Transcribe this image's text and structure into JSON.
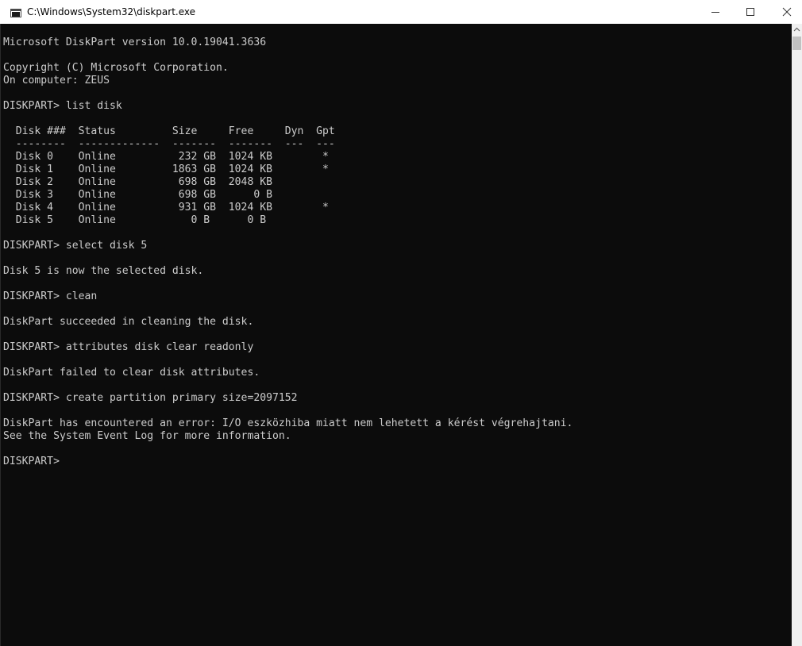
{
  "window": {
    "title": "C:\\Windows\\System32\\diskpart.exe"
  },
  "icons": {
    "app": "console-window-icon",
    "minimize": "minimize-icon",
    "maximize": "maximize-icon",
    "close": "close-icon",
    "scroll_up": "chevron-up-icon"
  },
  "colors": {
    "console_background": "#0c0c0c",
    "console_text": "#cccccc",
    "titlebar": "#ffffff"
  },
  "console": {
    "lines": [
      "Microsoft DiskPart version 10.0.19041.3636",
      "",
      "Copyright (C) Microsoft Corporation.",
      "On computer: ZEUS",
      "",
      "DISKPART> list disk",
      "",
      "  Disk ###  Status         Size     Free     Dyn  Gpt",
      "  --------  -------------  -------  -------  ---  ---",
      "  Disk 0    Online          232 GB  1024 KB        *",
      "  Disk 1    Online         1863 GB  1024 KB        *",
      "  Disk 2    Online          698 GB  2048 KB",
      "  Disk 3    Online          698 GB      0 B",
      "  Disk 4    Online          931 GB  1024 KB        *",
      "  Disk 5    Online            0 B      0 B",
      "",
      "DISKPART> select disk 5",
      "",
      "Disk 5 is now the selected disk.",
      "",
      "DISKPART> clean",
      "",
      "DiskPart succeeded in cleaning the disk.",
      "",
      "DISKPART> attributes disk clear readonly",
      "",
      "DiskPart failed to clear disk attributes.",
      "",
      "DISKPART> create partition primary size=2097152",
      "",
      "DiskPart has encountered an error: I/O eszközhiba miatt nem lehetett a kérést végrehajtani.",
      "See the System Event Log for more information.",
      "",
      "DISKPART>"
    ]
  }
}
